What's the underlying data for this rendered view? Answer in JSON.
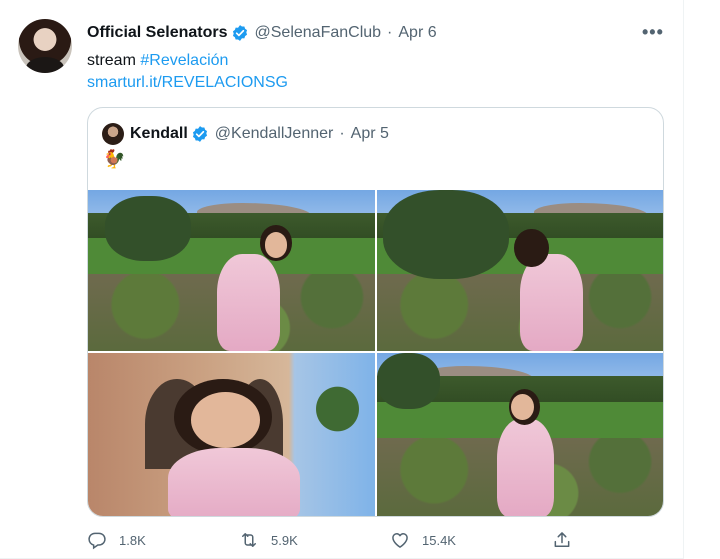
{
  "tweet": {
    "author_name": "Official Selenators",
    "handle": "@SelenaFanClub",
    "separator": "·",
    "date": "Apr 6",
    "more_label": "•••",
    "text_prefix": "stream",
    "hashtag": "#Revelación",
    "link": "smarturl.it/REVELACIONSG",
    "verified": true
  },
  "quote": {
    "author_name": "Kendall",
    "handle": "@KendallJenner",
    "separator": "·",
    "date": "Apr 5",
    "emoji": "🐓",
    "verified": true,
    "photos": [
      {
        "name": "photo-golf-course-1"
      },
      {
        "name": "photo-golf-course-2"
      },
      {
        "name": "photo-courtyard-smile"
      },
      {
        "name": "photo-golf-course-3"
      }
    ]
  },
  "actions": {
    "reply_count": "1.8K",
    "retweet_count": "5.9K",
    "like_count": "15.4K",
    "share_label": ""
  },
  "colors": {
    "accent": "#1d9bf0",
    "text_primary": "#0f1419",
    "text_secondary": "#536471",
    "border": "#cfd9de"
  },
  "icons": {
    "reply": "reply-icon",
    "retweet": "retweet-icon",
    "like": "heart-icon",
    "share": "share-icon",
    "verified": "verified-badge-icon"
  }
}
